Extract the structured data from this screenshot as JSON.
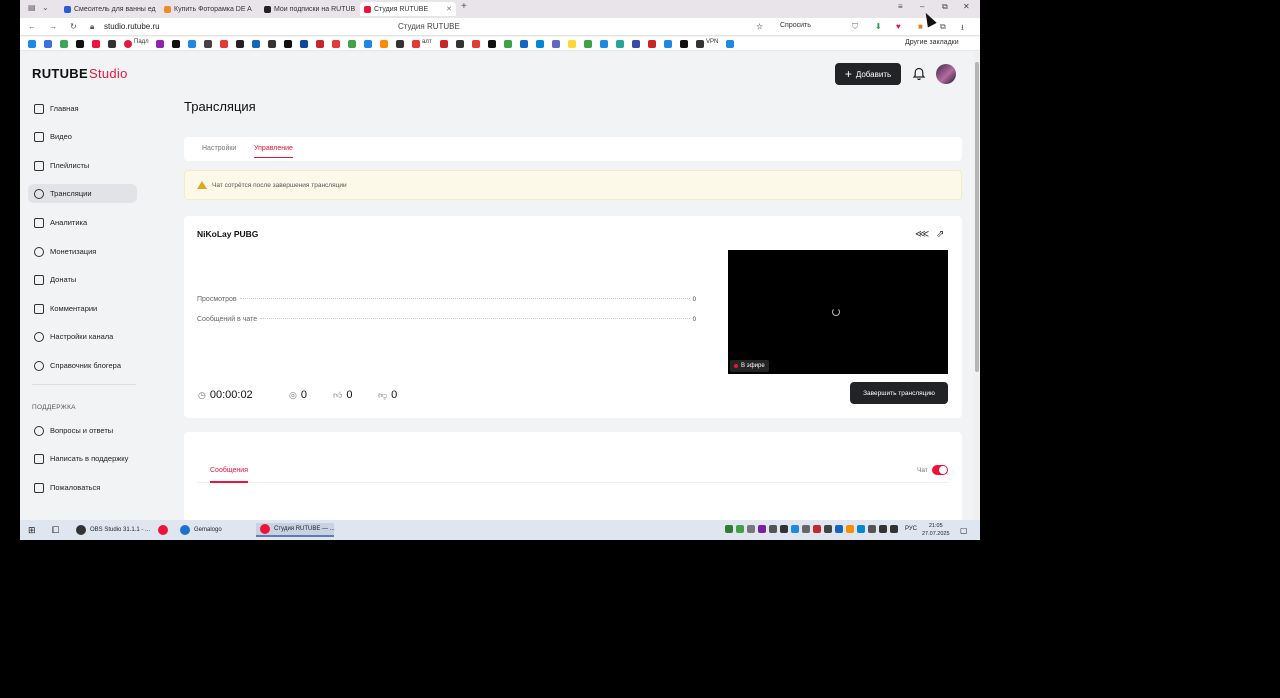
{
  "browser": {
    "tabs": [
      {
        "label": "Смеситель для ванны ед",
        "color": "#2c5bd6",
        "active": false
      },
      {
        "label": "Купить Фоторамка DE A",
        "color": "#f08a24",
        "active": false
      },
      {
        "label": "Мои подписки на RUTUB",
        "color": "#222222",
        "active": false
      },
      {
        "label": "Студия RUTUBE",
        "color": "#ed143b",
        "active": true
      }
    ],
    "url": "studio.rutube.ru",
    "page_title": "Студия RUTUBE",
    "ask_label": "Спросить",
    "bookmarks_text_1": "Падл",
    "bookmarks_text_2": "алт",
    "bookmarks_text_3": "VPN",
    "other_bookmarks": "Другие закладки"
  },
  "app": {
    "logo_main": "RUTUBE",
    "logo_studio": "Studio",
    "add_label": "Добавить",
    "sidebar": {
      "items": [
        {
          "label": "Главная",
          "icon": "home-icon",
          "active": false
        },
        {
          "label": "Видео",
          "icon": "video-icon",
          "active": false
        },
        {
          "label": "Плейлисты",
          "icon": "playlist-icon",
          "active": false
        },
        {
          "label": "Трансляции",
          "icon": "broadcast-icon",
          "active": true
        },
        {
          "label": "Аналитика",
          "icon": "analytics-icon",
          "active": false
        },
        {
          "label": "Монетизация",
          "icon": "monetization-icon",
          "active": false
        },
        {
          "label": "Донаты",
          "icon": "donate-icon",
          "active": false
        },
        {
          "label": "Комментарии",
          "icon": "comments-icon",
          "active": false
        },
        {
          "label": "Настройки канала",
          "icon": "gear-icon",
          "active": false
        },
        {
          "label": "Справочник блогера",
          "icon": "guide-icon",
          "active": false
        }
      ],
      "support_label": "ПОДДЕРЖКА",
      "support_items": [
        {
          "label": "Вопросы и ответы",
          "icon": "faq-icon"
        },
        {
          "label": "Написать в поддержку",
          "icon": "mail-icon"
        },
        {
          "label": "Пожаловаться",
          "icon": "flag-icon"
        }
      ]
    },
    "heading": "Трансляция",
    "page_tabs": [
      {
        "label": "Настройки",
        "active": false
      },
      {
        "label": "Управление",
        "active": true
      }
    ],
    "warning": "Чат сотрётся после завершения трансляции",
    "stream": {
      "title": "NiKoLay PUBG",
      "views_label": "Просмотров",
      "views_value": "0",
      "messages_label": "Сообщений в чате",
      "messages_value": "0",
      "live_label": "В эфире",
      "duration": "00:00:02",
      "viewers": "0",
      "likes": "0",
      "dislikes": "0",
      "end_label": "Завершить трансляцию"
    },
    "chat": {
      "tab_label": "Сообщения",
      "toggle_label": "Чат",
      "toggle_on": true
    }
  },
  "taskbar": {
    "items": [
      {
        "label": "OBS Studio 31.1.1 - ...",
        "color": "#333333",
        "active": false
      },
      {
        "label": "",
        "color": "#ed143b",
        "active": false
      },
      {
        "label": "Gemalogo",
        "color": "#1f6fd1",
        "active": false
      },
      {
        "label": "Студия RUTUBE — ...",
        "color": "#ed143b",
        "active": true
      }
    ],
    "lang": "РУС",
    "time": "21:05",
    "date": "27.07.2025"
  },
  "colors": {
    "accent": "#ed143b",
    "dark_button": "#222326",
    "warning_bg": "#fdf9e8"
  }
}
